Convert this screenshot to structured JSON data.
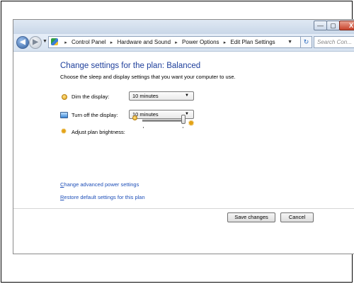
{
  "window": {
    "caption_min": "—",
    "caption_max": "▢",
    "caption_close": "X"
  },
  "nav": {
    "back_glyph": "◀",
    "forward_glyph": "▶",
    "recent_glyph": "▼",
    "breadcrumbs": [
      "Control Panel",
      "Hardware and Sound",
      "Power Options",
      "Edit Plan Settings"
    ],
    "separator": "▸",
    "address_dropdown": "▼",
    "refresh_glyph": "↻",
    "search_placeholder": "Search Con...",
    "search_glyph": "⌕"
  },
  "page": {
    "title": "Change settings for the plan: Balanced",
    "subtitle": "Choose the sleep and display settings that you want your computer to use.",
    "dim_label": "Dim the display:",
    "dim_value": "10 minutes",
    "turnoff_label": "Turn off the display:",
    "turnoff_value": "10 minutes",
    "brightness_label": "Adjust plan brightness:",
    "brightness_level": 1.0,
    "brightness_icon_low": "sun-small-icon",
    "brightness_icon_high": "sun-large-icon",
    "dropdown_arrow": "▼",
    "link_advanced_first": "C",
    "link_advanced_rest": "hange advanced power settings",
    "link_restore_first": "R",
    "link_restore_rest": "estore default settings for this plan",
    "save_label": "Save changes",
    "cancel_label": "Cancel"
  }
}
